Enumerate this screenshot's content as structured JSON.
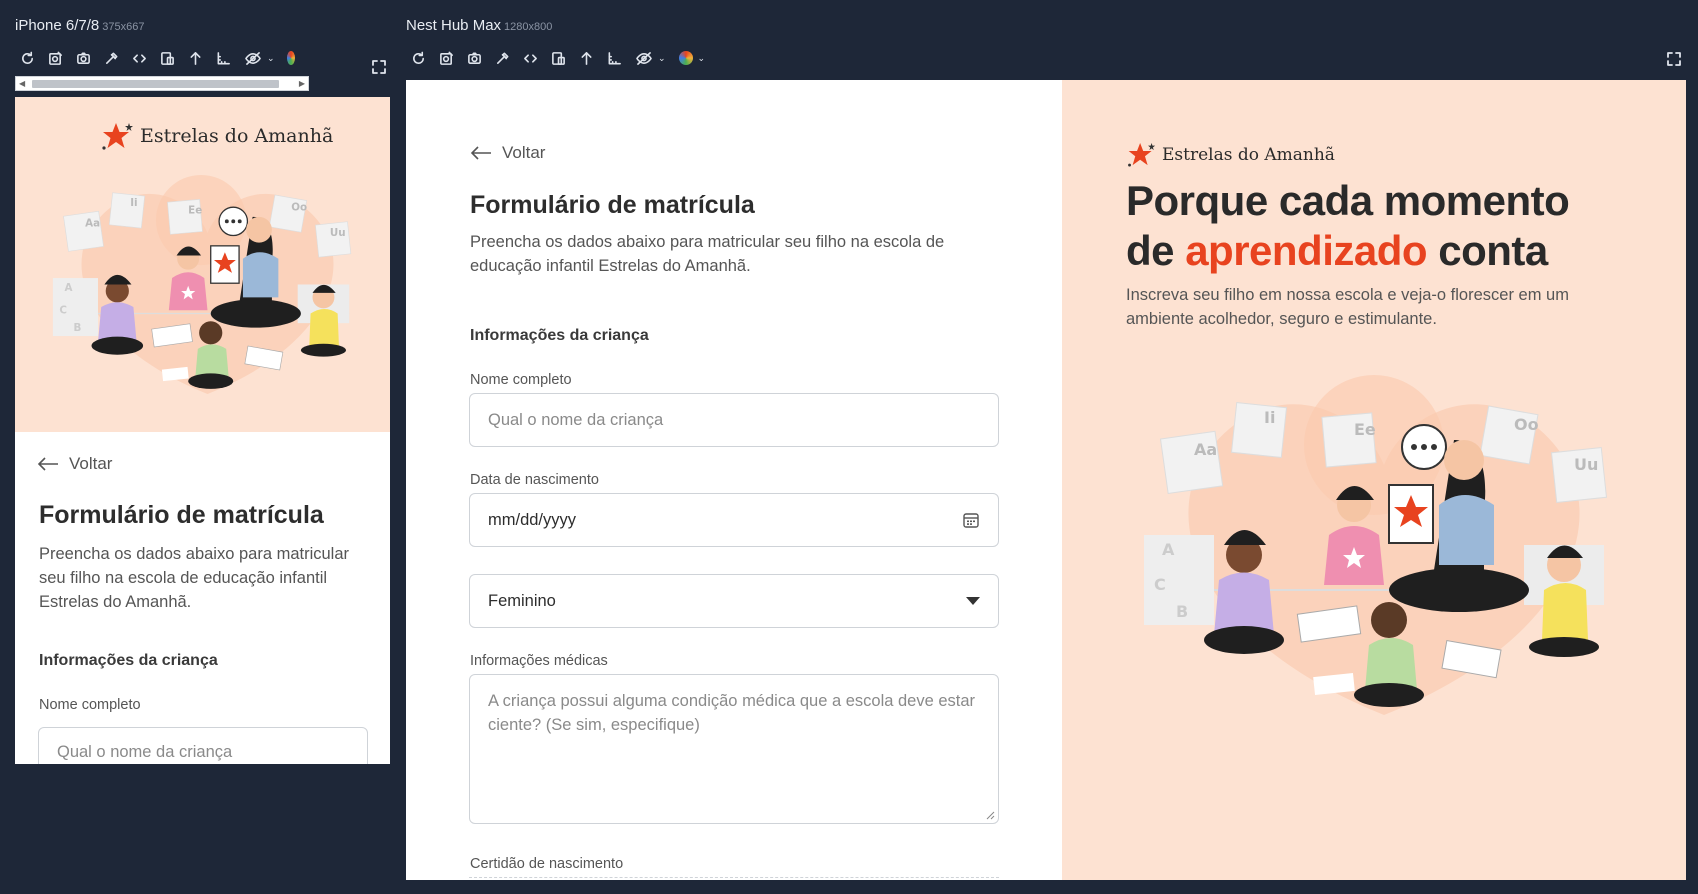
{
  "devices": {
    "left": {
      "name": "iPhone 6/7/8",
      "dims": "375x667"
    },
    "right": {
      "name": "Nest Hub Max",
      "dims": "1280x800"
    }
  },
  "icons": [
    "refresh-icon",
    "screenshot-edit-icon",
    "camera-icon",
    "eyedropper-icon",
    "code-icon",
    "responsive-icon",
    "arrow-up-icon",
    "ruler-icon",
    "eye-off-icon",
    "color-wheel-icon",
    "expand-icon"
  ],
  "colors": {
    "accent": "#e8431f",
    "peach": "#fde2d2",
    "background": "#1e2738"
  },
  "brand": {
    "name": "Estrelas do Amanhã"
  },
  "form": {
    "back": "Voltar",
    "title": "Formulário de matrícula",
    "description": "Preencha os dados abaixo para matricular seu filho na escola de educação infantil Estrelas do Amanhã.",
    "section_child": "Informações da criança",
    "name_label": "Nome completo",
    "name_placeholder": "Qual o nome da criança",
    "dob_label": "Data de nascimento",
    "dob_placeholder": "mm/dd/yyyy",
    "gender_value": "Feminino",
    "medical_label": "Informações médicas",
    "medical_placeholder": "A criança possui alguma condição médica que a escola deve estar ciente? (Se sim, especifique)",
    "certificate_label": "Certidão de nascimento"
  },
  "hero": {
    "title_part1": "Porque cada momento",
    "title_part2a": "de ",
    "title_accent": "aprendizado",
    "title_part2b": " conta",
    "subtitle": "Inscreva seu filho em nossa escola e veja-o florescer em um ambiente acolhedor, seguro e estimulante."
  },
  "illustration": {
    "card_letters": [
      "Aa",
      "Ii",
      "Ee",
      "Oo",
      "Uu"
    ],
    "block_letters": [
      "A",
      "C",
      "B"
    ]
  }
}
